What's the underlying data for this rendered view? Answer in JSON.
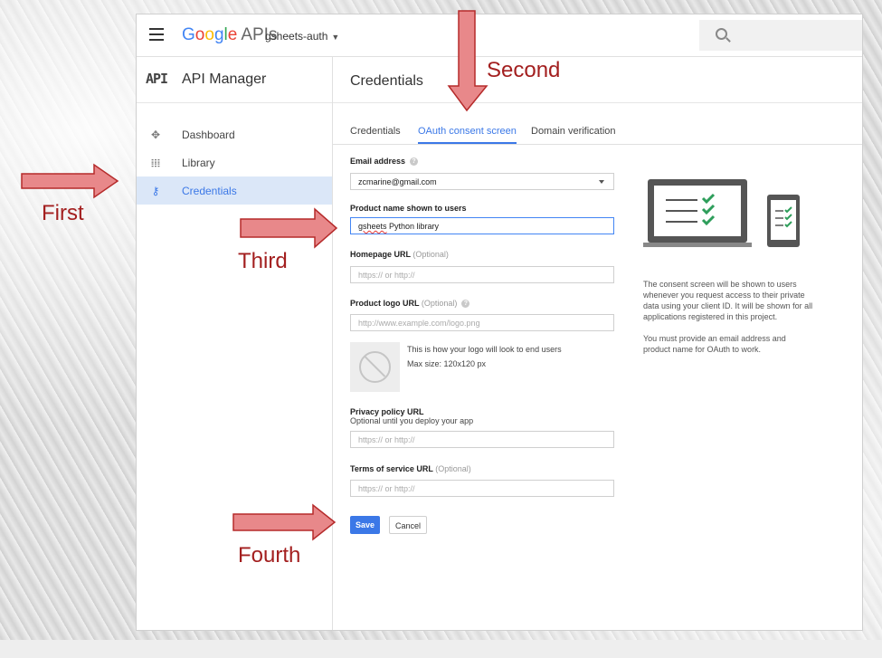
{
  "topbar": {
    "brand_google": "Google",
    "brand_apis": "APIs",
    "project": "gsheets-auth"
  },
  "sidebar": {
    "logo": "API",
    "title": "API Manager",
    "items": [
      {
        "label": "Dashboard"
      },
      {
        "label": "Library"
      },
      {
        "label": "Credentials"
      }
    ]
  },
  "main": {
    "title": "Credentials",
    "tabs": [
      {
        "label": "Credentials"
      },
      {
        "label": "OAuth consent screen"
      },
      {
        "label": "Domain verification"
      }
    ]
  },
  "form": {
    "email_label": "Email address",
    "email_value": "zcmarine@gmail.com",
    "product_label": "Product name shown to users",
    "product_value_misspelled": "gsheets",
    "product_value_rest": " Python library",
    "homepage_label": "Homepage URL",
    "homepage_optional": "(Optional)",
    "homepage_placeholder": "https:// or http://",
    "logo_label": "Product logo URL",
    "logo_optional": "(Optional)",
    "logo_placeholder": "http://www.example.com/logo.png",
    "logo_note_1": "This is how your logo will look to end users",
    "logo_note_2": "Max size: 120x120 px",
    "privacy_label": "Privacy policy URL",
    "privacy_sublabel": "Optional until you deploy your app",
    "privacy_placeholder": "https:// or http://",
    "tos_label": "Terms of service URL",
    "tos_optional": "(Optional)",
    "tos_placeholder": "https:// or http://",
    "save_label": "Save",
    "cancel_label": "Cancel"
  },
  "info": {
    "para1": "The consent screen will be shown to users whenever you request access to their private data using your client ID. It will be shown for all applications registered in this project.",
    "para2": "You must provide an email address and product name for OAuth to work."
  },
  "annotations": {
    "first": "First",
    "second": "Second",
    "third": "Third",
    "fourth": "Fourth",
    "arrow_color": "#e8888a",
    "arrow_stroke": "#b52a2a",
    "text_color": "#a31f1f"
  },
  "colors": {
    "accent": "#3b78e7",
    "active_nav_bg": "#dbe7f8",
    "illustration_green": "#2e9e5b"
  }
}
